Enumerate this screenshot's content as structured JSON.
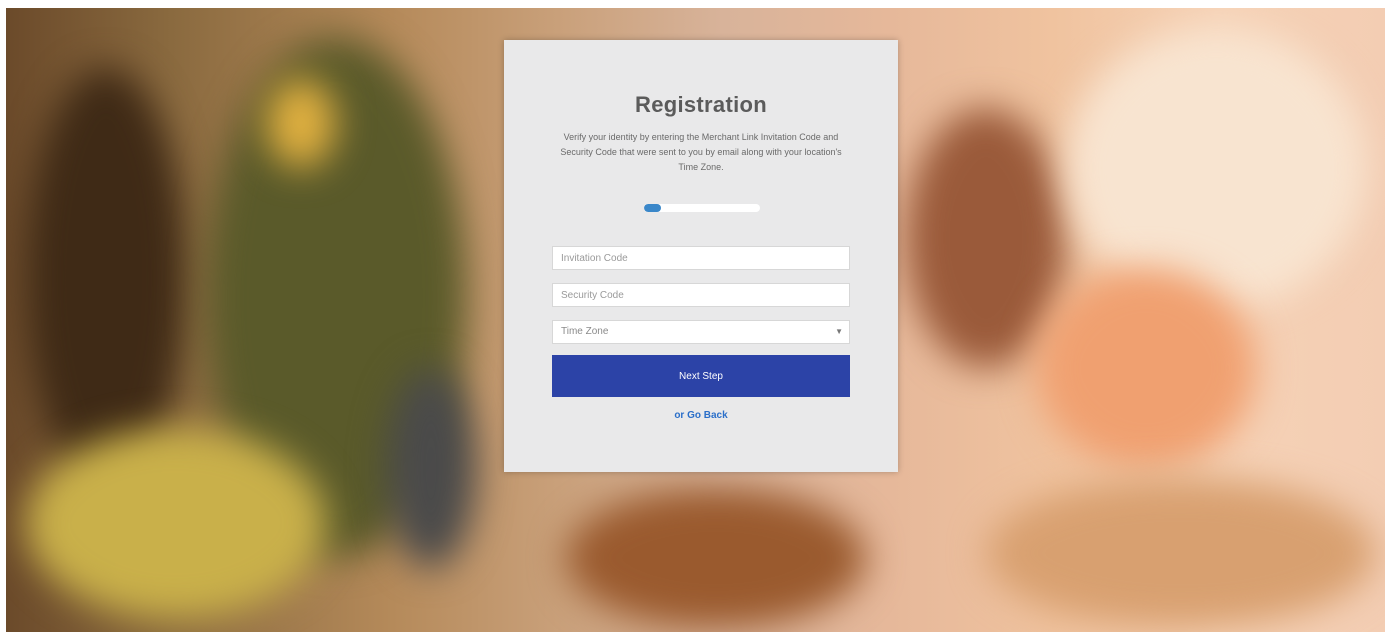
{
  "form": {
    "title": "Registration",
    "description": "Verify your identity by entering the Merchant Link Invitation Code and Security Code that were sent to you by email along with your location's Time Zone.",
    "progress_fraction": 0.15,
    "invitation_code": {
      "value": "",
      "placeholder": "Invitation Code"
    },
    "security_code": {
      "value": "",
      "placeholder": "Security Code"
    },
    "time_zone": {
      "selected": "Time Zone"
    },
    "next_button_label": "Next Step",
    "back_link_label": "or Go Back"
  },
  "colors": {
    "panel_bg": "#e9e9ea",
    "button_bg": "#2c43a7",
    "link": "#2b6fc9",
    "progress": "#3a87c9"
  },
  "icons": {
    "select_chevron": "chevron-down-icon"
  }
}
